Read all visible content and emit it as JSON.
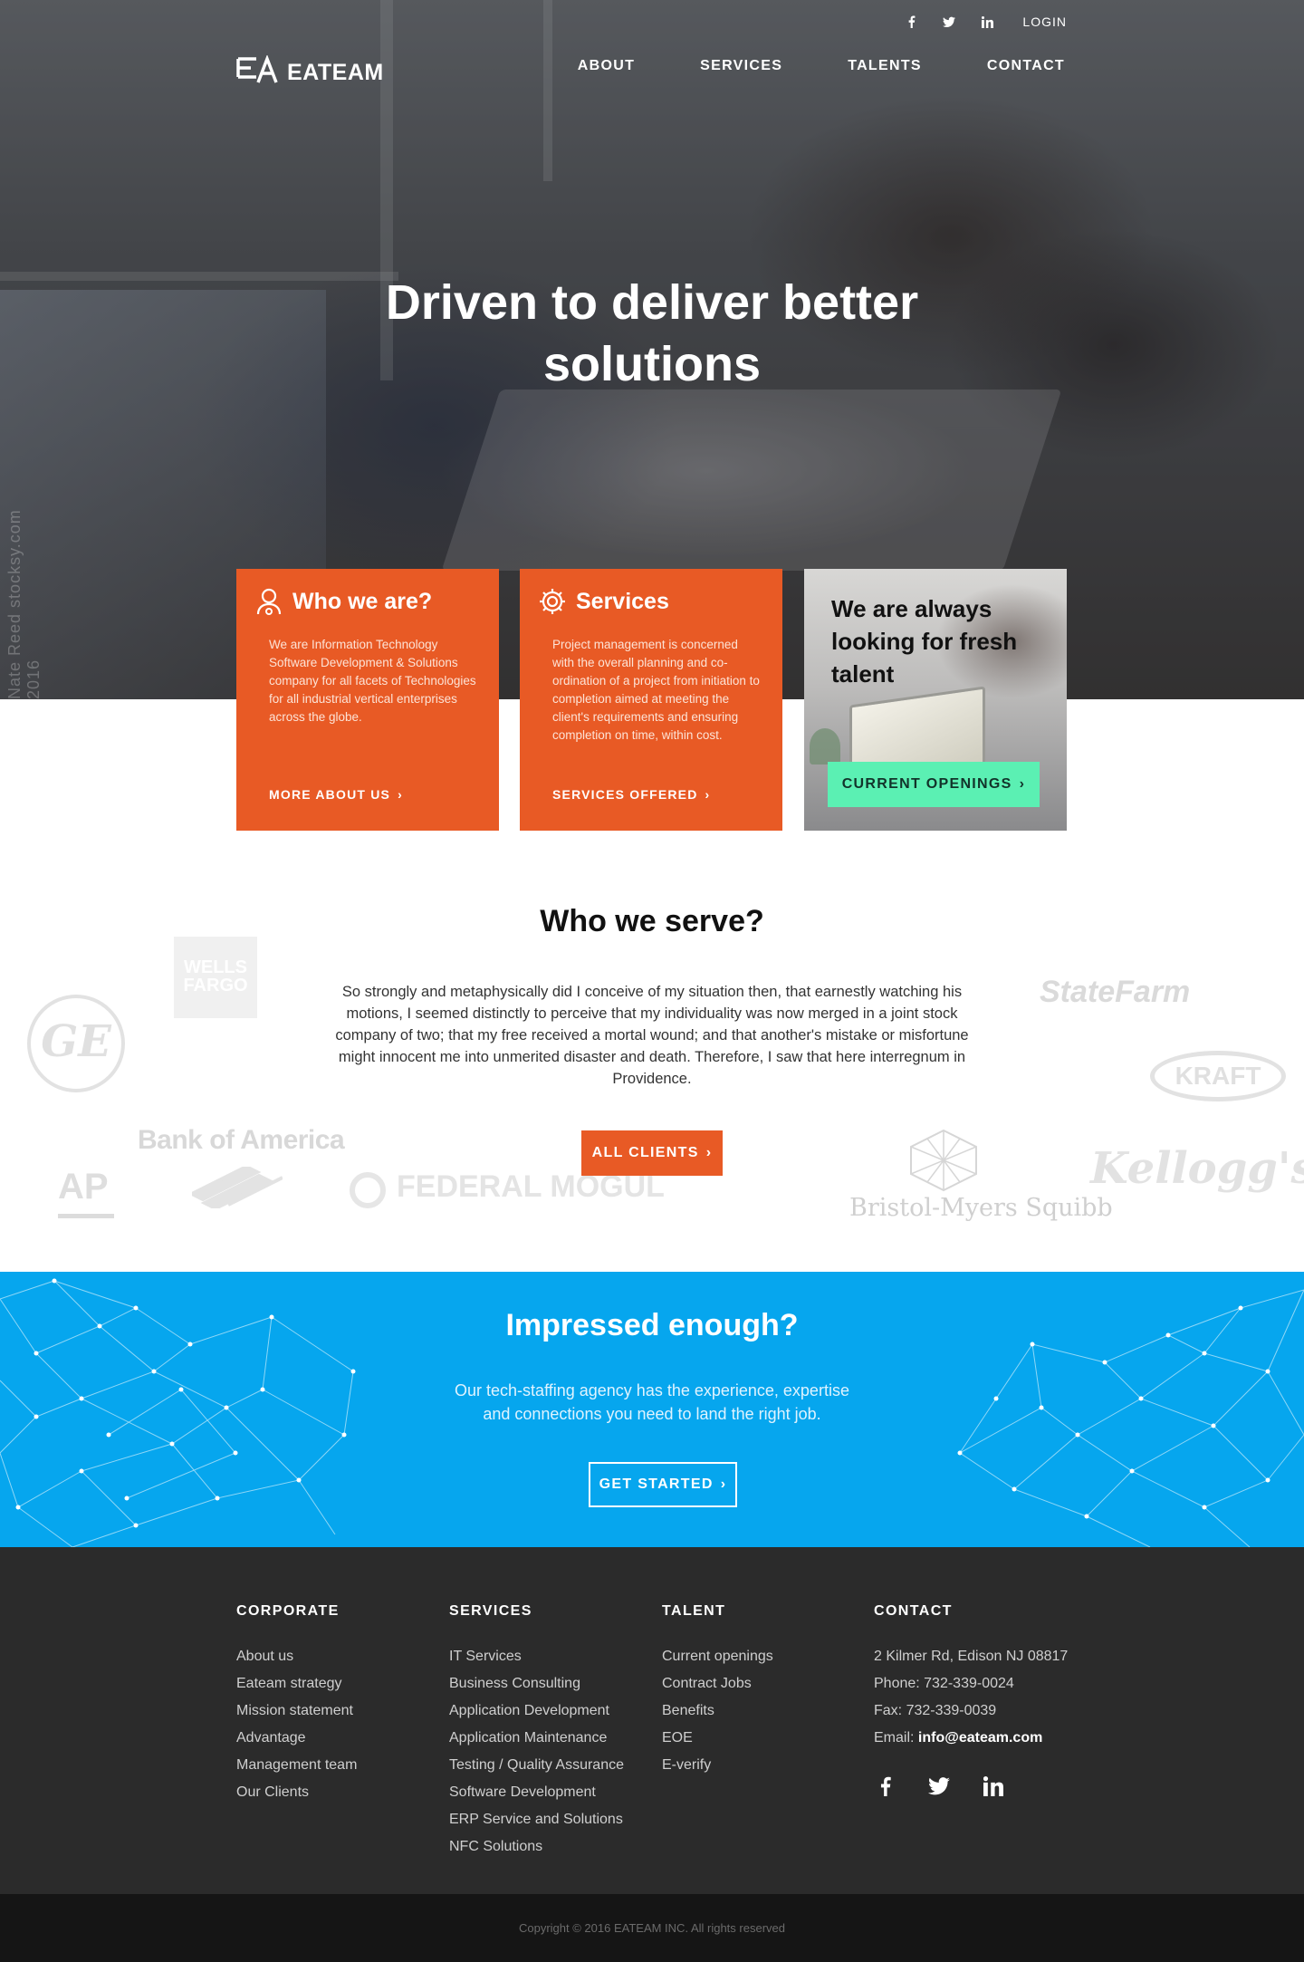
{
  "topbar": {
    "login": "LOGIN",
    "icons": [
      "facebook-icon",
      "twitter-icon",
      "linkedin-icon"
    ]
  },
  "brand": {
    "name": "EATEAM"
  },
  "nav": {
    "items": [
      {
        "label": "ABOUT"
      },
      {
        "label": "SERVICES"
      },
      {
        "label": "TALENTS"
      },
      {
        "label": "CONTACT"
      }
    ]
  },
  "hero": {
    "title": "Driven to deliver better solutions",
    "watermark": "Nate Reed  stocksy.com  2016"
  },
  "cards": {
    "who": {
      "title": "Who we are?",
      "body": "We are Information Technology Software Development & Solutions company for all facets of Technologies for all industrial vertical enterprises across the globe.",
      "cta": "MORE ABOUT US"
    },
    "services": {
      "title": "Services",
      "body": "Project management is concerned with the overall planning and co-ordination of a project from initiation to completion aimed at meeting the client's requirements and ensuring completion on time, within cost.",
      "cta": "SERVICES OFFERED"
    },
    "talent": {
      "title": "We are always looking for fresh talent",
      "cta": "CURRENT OPENINGS"
    }
  },
  "serve": {
    "title": "Who we serve?",
    "text": "So strongly and metaphysically did I conceive of my situation then, that  earnestly watching his motions, I seemed distinctly to perceive that my  individuality was now merged in a joint stock company of two; that my free  received a mortal wound; and that another's mistake or misfortune might innocent me into unmerited disaster and death. Therefore, I saw that here interregnum in Providence.",
    "cta": "ALL CLIENTS",
    "logos": {
      "wells": "WELLS FARGO",
      "ge": "GE",
      "boa": "Bank of America",
      "ap": "AP",
      "fedmogul": "FEDERAL MOGUL",
      "statefarm": "StateFarm",
      "kraft": "KRAFT",
      "kelloggs": "Kellogg's",
      "bms": "Bristol-Myers Squibb"
    }
  },
  "impressed": {
    "title": "Impressed enough?",
    "text": "Our tech-staffing agency has the experience, expertise and connections you need to land the right job.",
    "cta": "GET STARTED"
  },
  "footer": {
    "corporate": {
      "heading": "CORPORATE",
      "items": [
        "About us",
        "Eateam strategy",
        "Mission statement",
        "Advantage",
        "Management team",
        "Our Clients"
      ]
    },
    "services": {
      "heading": "SERVICES",
      "items": [
        "IT Services",
        "Business Consulting",
        "Application Development",
        "Application Maintenance",
        "Testing / Quality Assurance",
        "Software Development",
        "ERP Service and Solutions",
        "NFC Solutions"
      ]
    },
    "talent": {
      "heading": "TALENT",
      "items": [
        "Current openings",
        "Contract Jobs",
        "Benefits",
        "EOE",
        "E-verify"
      ]
    },
    "contact": {
      "heading": "CONTACT",
      "address": "2 Kilmer Rd, Edison NJ 08817",
      "phone": "Phone: 732-339-0024",
      "fax": "Fax: 732-339-0039",
      "email_label": "Email: ",
      "email": "info@eateam.com"
    },
    "social_icons": [
      "facebook-icon",
      "twitter-icon",
      "linkedin-icon"
    ],
    "copyright": "Copyright © 2016 EATEAM INC. All rights reserved"
  },
  "colors": {
    "accent_orange": "#e85a25",
    "accent_blue": "#06a6ee",
    "accent_green": "#5bf0b3",
    "footer_bg": "#2b2b2b"
  }
}
